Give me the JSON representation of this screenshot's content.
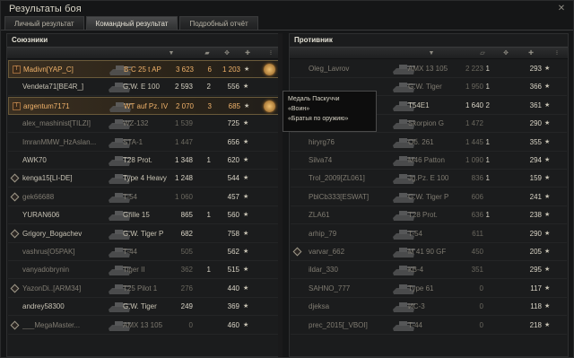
{
  "window": {
    "title": "Результаты боя",
    "close": "✕"
  },
  "tabs": [
    "Личный результат",
    "Командный результат",
    "Подробный отчёт"
  ],
  "left": {
    "title": "Союзники",
    "rows": [
      {
        "name": "Madivn[YAP_C]",
        "tank": "B-C 25 t AP",
        "dmg": "3 623",
        "kills": "6",
        "xp": "1 203",
        "state": "me",
        "platoon": true,
        "medal": true
      },
      {
        "name": "Vendeta71[BE4R_]",
        "tank": "G.W. E 100",
        "dmg": "2 593",
        "kills": "2",
        "xp": "556",
        "state": "alive"
      },
      {
        "name": "argentum7171",
        "tank": "WT auf Pz. IV",
        "dmg": "2 070",
        "kills": "3",
        "xp": "685",
        "state": "me",
        "platoon": true,
        "medal": true
      },
      {
        "name": "alex_mashinist[TILZI]",
        "tank": "WZ-132",
        "dmg": "1 539",
        "kills": "",
        "xp": "725",
        "state": "dead"
      },
      {
        "name": "ImranMMW_HzAslan...",
        "tank": "STA-1",
        "dmg": "1 447",
        "kills": "",
        "xp": "656",
        "state": "dead"
      },
      {
        "name": "AWK70",
        "tank": "T28 Prot.",
        "dmg": "1 348",
        "kills": "1",
        "xp": "620",
        "state": "alive"
      },
      {
        "name": "kenga15[LI-DE]",
        "tank": "Type 4 Heavy",
        "dmg": "1 248",
        "kills": "",
        "xp": "544",
        "state": "alive",
        "diamond": true
      },
      {
        "name": "gek66688",
        "tank": "T-54",
        "dmg": "1 060",
        "kills": "",
        "xp": "457",
        "state": "dead",
        "diamond": true
      },
      {
        "name": "YURAN606",
        "tank": "Grille 15",
        "dmg": "865",
        "kills": "1",
        "xp": "560",
        "state": "alive"
      },
      {
        "name": "Grigory_Bogachev",
        "tank": "G.W. Tiger P",
        "dmg": "682",
        "kills": "",
        "xp": "758",
        "state": "alive",
        "diamond": true
      },
      {
        "name": "vashrus[O5PAK]",
        "tank": "T-44",
        "dmg": "505",
        "kills": "",
        "xp": "562",
        "state": "dead"
      },
      {
        "name": "vanyadobrynin",
        "tank": "Tiger II",
        "dmg": "362",
        "kills": "1",
        "xp": "515",
        "state": "dead"
      },
      {
        "name": "YazonDi..[ARM34]",
        "tank": "T25 Pilot 1",
        "dmg": "276",
        "kills": "",
        "xp": "440",
        "state": "dead",
        "diamond": true
      },
      {
        "name": "andrey58300",
        "tank": "G.W. Tiger",
        "dmg": "249",
        "kills": "",
        "xp": "369",
        "state": "alive"
      },
      {
        "name": "___MegaMaster...",
        "tank": "AMX 13 105",
        "dmg": "0",
        "kills": "",
        "xp": "460",
        "state": "dead",
        "diamond": true
      }
    ]
  },
  "right": {
    "title": "Противник",
    "rows": [
      {
        "name": "Oleg_Lavrov",
        "tank": "AMX 13 105",
        "dmg": "2 223",
        "kills": "1",
        "xp": "293",
        "state": "dead"
      },
      {
        "name": "",
        "tank": "G.W. Tiger",
        "dmg": "1 950",
        "kills": "1",
        "xp": "366",
        "state": "dead"
      },
      {
        "name": "",
        "tank": "T54E1",
        "dmg": "1 640",
        "kills": "2",
        "xp": "361",
        "state": "alive"
      },
      {
        "name": "",
        "tank": "Skorpion G",
        "dmg": "1 472",
        "kills": "",
        "xp": "290",
        "state": "dead"
      },
      {
        "name": "hiryrg76",
        "tank": "Об. 261",
        "dmg": "1 445",
        "kills": "1",
        "xp": "355",
        "state": "dead"
      },
      {
        "name": "Silva74",
        "tank": "M46 Patton",
        "dmg": "1 090",
        "kills": "1",
        "xp": "294",
        "state": "dead"
      },
      {
        "name": "Trol_2009[ZL061]",
        "tank": "Jg.Pz. E 100",
        "dmg": "836",
        "kills": "1",
        "xp": "159",
        "state": "dead"
      },
      {
        "name": "PblCb333[ESWAT]",
        "tank": "G.W. Tiger P",
        "dmg": "606",
        "kills": "",
        "xp": "241",
        "state": "dead"
      },
      {
        "name": "ZLA61",
        "tank": "T28 Prot.",
        "dmg": "636",
        "kills": "1",
        "xp": "238",
        "state": "dead"
      },
      {
        "name": "arhip_79",
        "tank": "T-54",
        "dmg": "611",
        "kills": "",
        "xp": "290",
        "state": "dead"
      },
      {
        "name": "varvar_662",
        "tank": "M 41 90 GF",
        "dmg": "450",
        "kills": "",
        "xp": "205",
        "state": "dead",
        "diamond": true
      },
      {
        "name": "ildar_330",
        "tank": "КВ-4",
        "dmg": "351",
        "kills": "",
        "xp": "295",
        "state": "dead"
      },
      {
        "name": "SAHNO_777",
        "tank": "Type 61",
        "dmg": "0",
        "kills": "",
        "xp": "117",
        "state": "dead"
      },
      {
        "name": "djeksa",
        "tank": "ИС-3",
        "dmg": "0",
        "kills": "",
        "xp": "118",
        "state": "dead"
      },
      {
        "name": "prec_2015[_VBOI]",
        "tank": "T-44",
        "dmg": "0",
        "kills": "",
        "xp": "218",
        "state": "dead"
      }
    ]
  },
  "tooltip": {
    "line1": "Медаль Паскуччи",
    "line2": "«Воин»",
    "line3": "«Братья по оружию»"
  },
  "icons": {
    "close": "close-icon",
    "platoon": "platoon-icon",
    "star": "star-icon",
    "medal": "medal-icon"
  }
}
